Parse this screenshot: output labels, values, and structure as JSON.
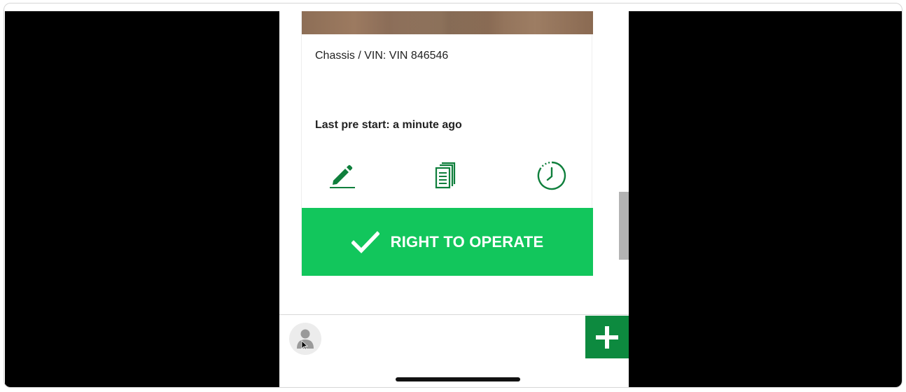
{
  "vehicle_card": {
    "vin_text": "Chassis / VIN: VIN 846546",
    "last_prestart_text": "Last pre start: a minute ago",
    "right_to_operate_label": "RIGHT TO OPERATE"
  },
  "icons": {
    "edit": "pencil-icon",
    "documents": "documents-icon",
    "history": "history-clock-icon",
    "confirm": "checkmark-icon",
    "user": "user-avatar-icon",
    "add": "plus-icon"
  },
  "colors": {
    "brand_green": "#12c65c",
    "dark_green": "#0d8a3f",
    "icon_green": "#0f7f3c",
    "text": "#222222"
  }
}
